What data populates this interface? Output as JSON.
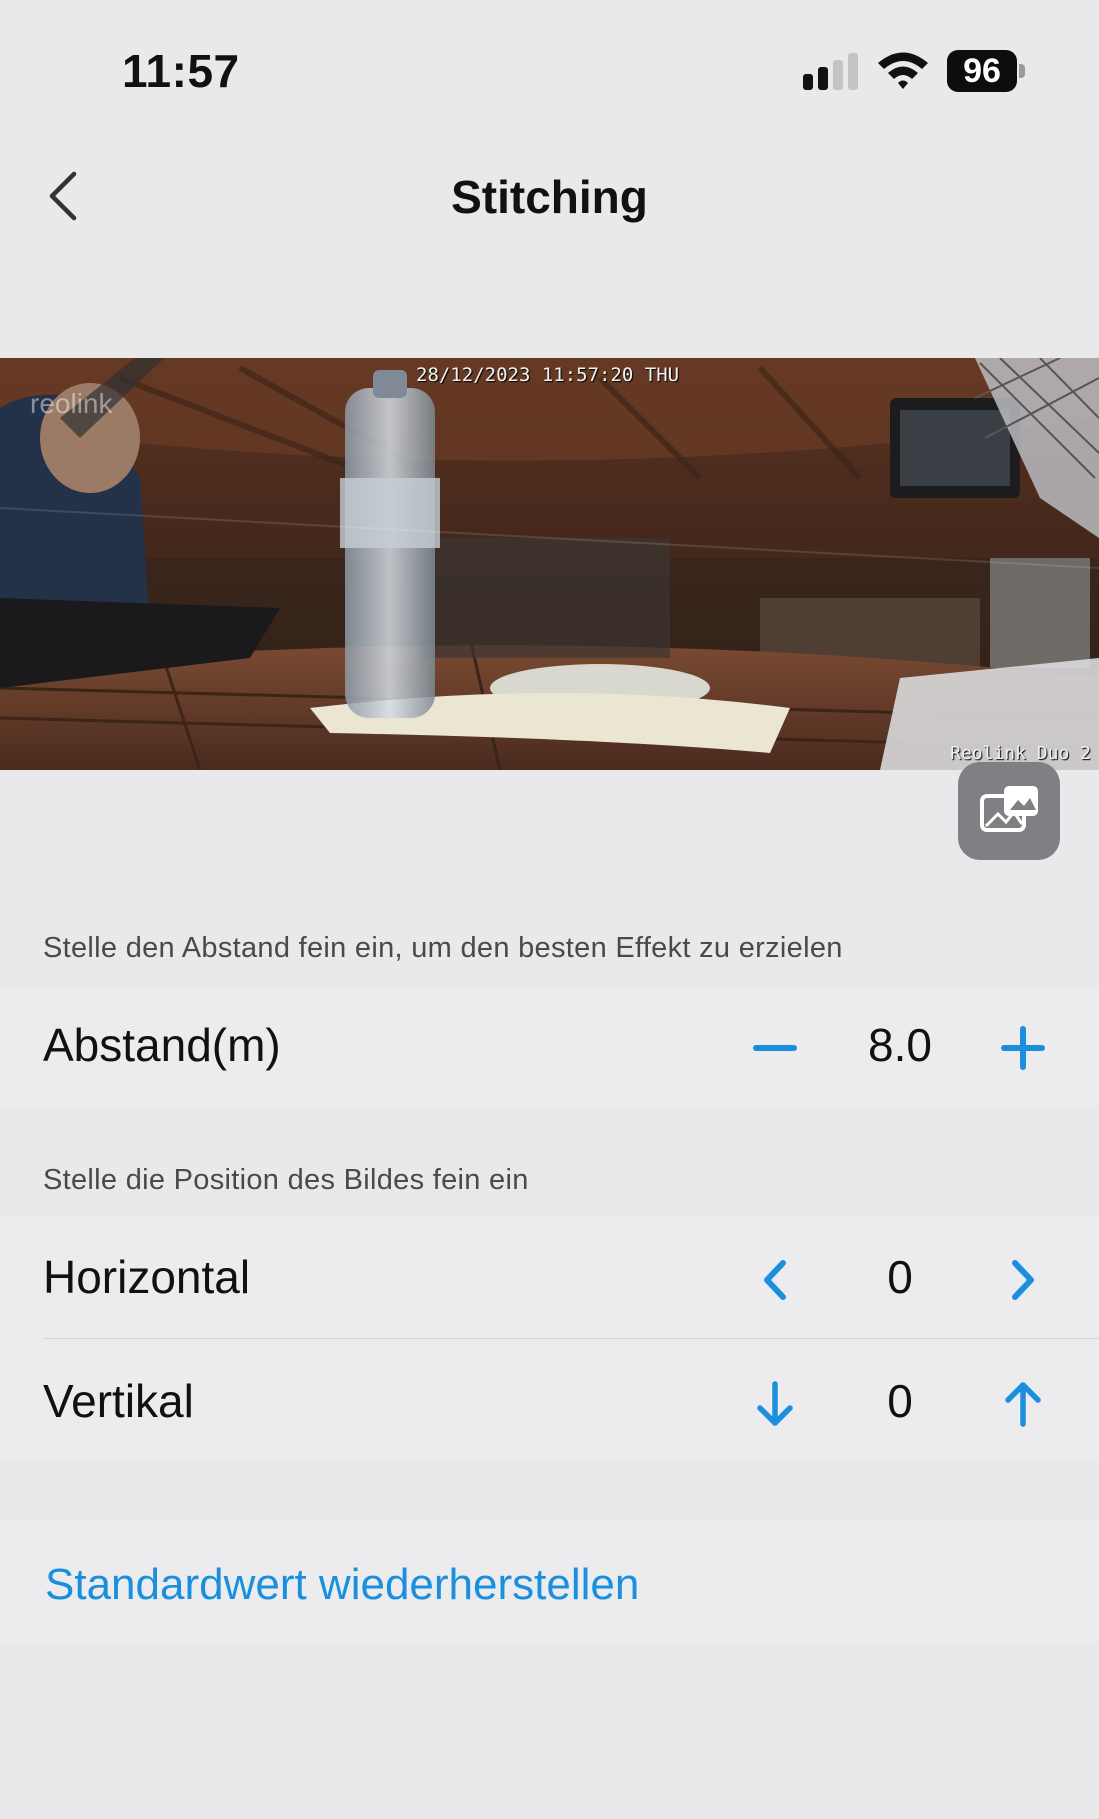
{
  "status_bar": {
    "time": "11:57",
    "battery": "96"
  },
  "nav": {
    "title": "Stitching"
  },
  "preview": {
    "timestamp": "28/12/2023 11:57:20 THU",
    "brand": "Reolink Duo 2",
    "logo": "reolink"
  },
  "distance_section": {
    "caption": "Stelle den Abstand fein ein, um den besten Effekt zu erzielen",
    "label": "Abstand(m)",
    "value": "8.0"
  },
  "position_section": {
    "caption": "Stelle die Position des Bildes fein ein",
    "horizontal": {
      "label": "Horizontal",
      "value": "0"
    },
    "vertical": {
      "label": "Vertikal",
      "value": "0"
    }
  },
  "restore": {
    "label": "Standardwert wiederherstellen"
  },
  "colors": {
    "accent": "#1a8fde",
    "background": "#e9e9eb"
  }
}
